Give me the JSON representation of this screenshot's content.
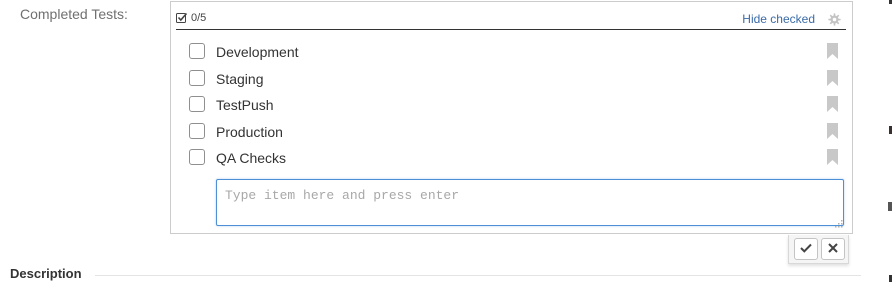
{
  "field": {
    "label": "Completed Tests:"
  },
  "checklist": {
    "progress": "0/5",
    "checked_count": 0,
    "total_count": 5,
    "hide_checked_label": "Hide checked",
    "items": [
      {
        "label": "Development",
        "checked": false
      },
      {
        "label": "Staging",
        "checked": false
      },
      {
        "label": "TestPush",
        "checked": false
      },
      {
        "label": "Production",
        "checked": false
      },
      {
        "label": "QA Checks",
        "checked": false
      }
    ],
    "input": {
      "value": "",
      "placeholder": "Type item here and press enter"
    }
  },
  "actions": {
    "save_icon": "check-icon",
    "cancel_icon": "close-icon"
  },
  "description": {
    "title": "Description"
  },
  "colors": {
    "link": "#3a6ba8",
    "input_focus_border": "#4d90d6",
    "bookmark": "#c8c8c8",
    "label": "#707070"
  }
}
